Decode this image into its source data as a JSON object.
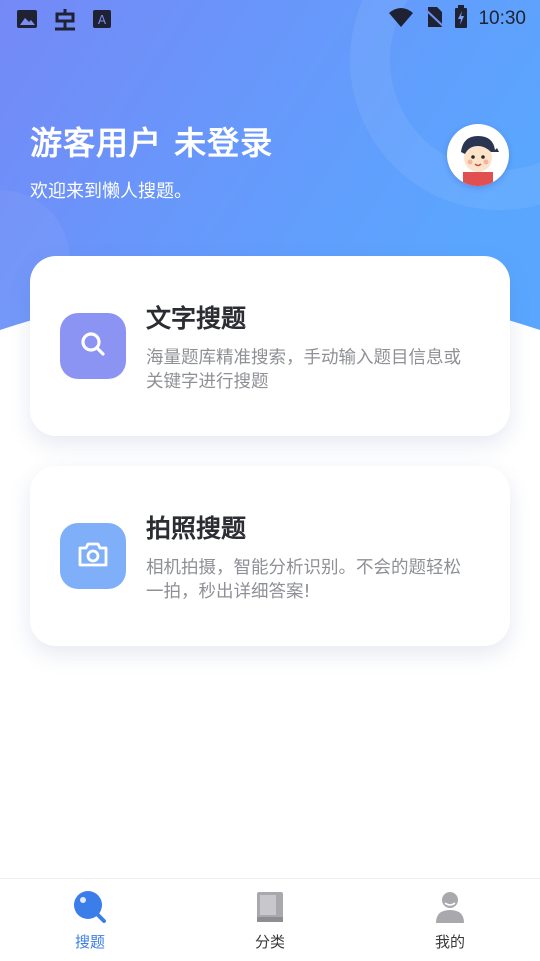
{
  "status_bar": {
    "time": "10:30",
    "left_icons": [
      "image-icon",
      "app-bug-icon",
      "font-a-icon"
    ],
    "right_icons": [
      "wifi-icon",
      "no-sim-icon",
      "battery-charging-icon"
    ]
  },
  "header": {
    "title": "游客用户 未登录",
    "subtitle": "欢迎来到懒人搜题。"
  },
  "cards": [
    {
      "title": "文字搜题",
      "description": "海量题库精准搜索，手动输入题目信息或关键字进行搜题",
      "icon": "search-icon",
      "icon_color": "#8b93f3"
    },
    {
      "title": "拍照搜题",
      "description": "相机拍摄，智能分析识别。不会的题轻松一拍，秒出详细答案!",
      "icon": "camera-icon",
      "icon_color": "#7eaff8"
    }
  ],
  "tabbar": {
    "items": [
      {
        "label": "搜题",
        "icon": "search-tab-icon",
        "active": true
      },
      {
        "label": "分类",
        "icon": "book-icon",
        "active": false
      },
      {
        "label": "我的",
        "icon": "user-icon",
        "active": false
      }
    ]
  },
  "colors": {
    "header_gradient_start": "#6f86f5",
    "header_gradient_end": "#5aa6ff",
    "accent": "#3b7de9"
  }
}
